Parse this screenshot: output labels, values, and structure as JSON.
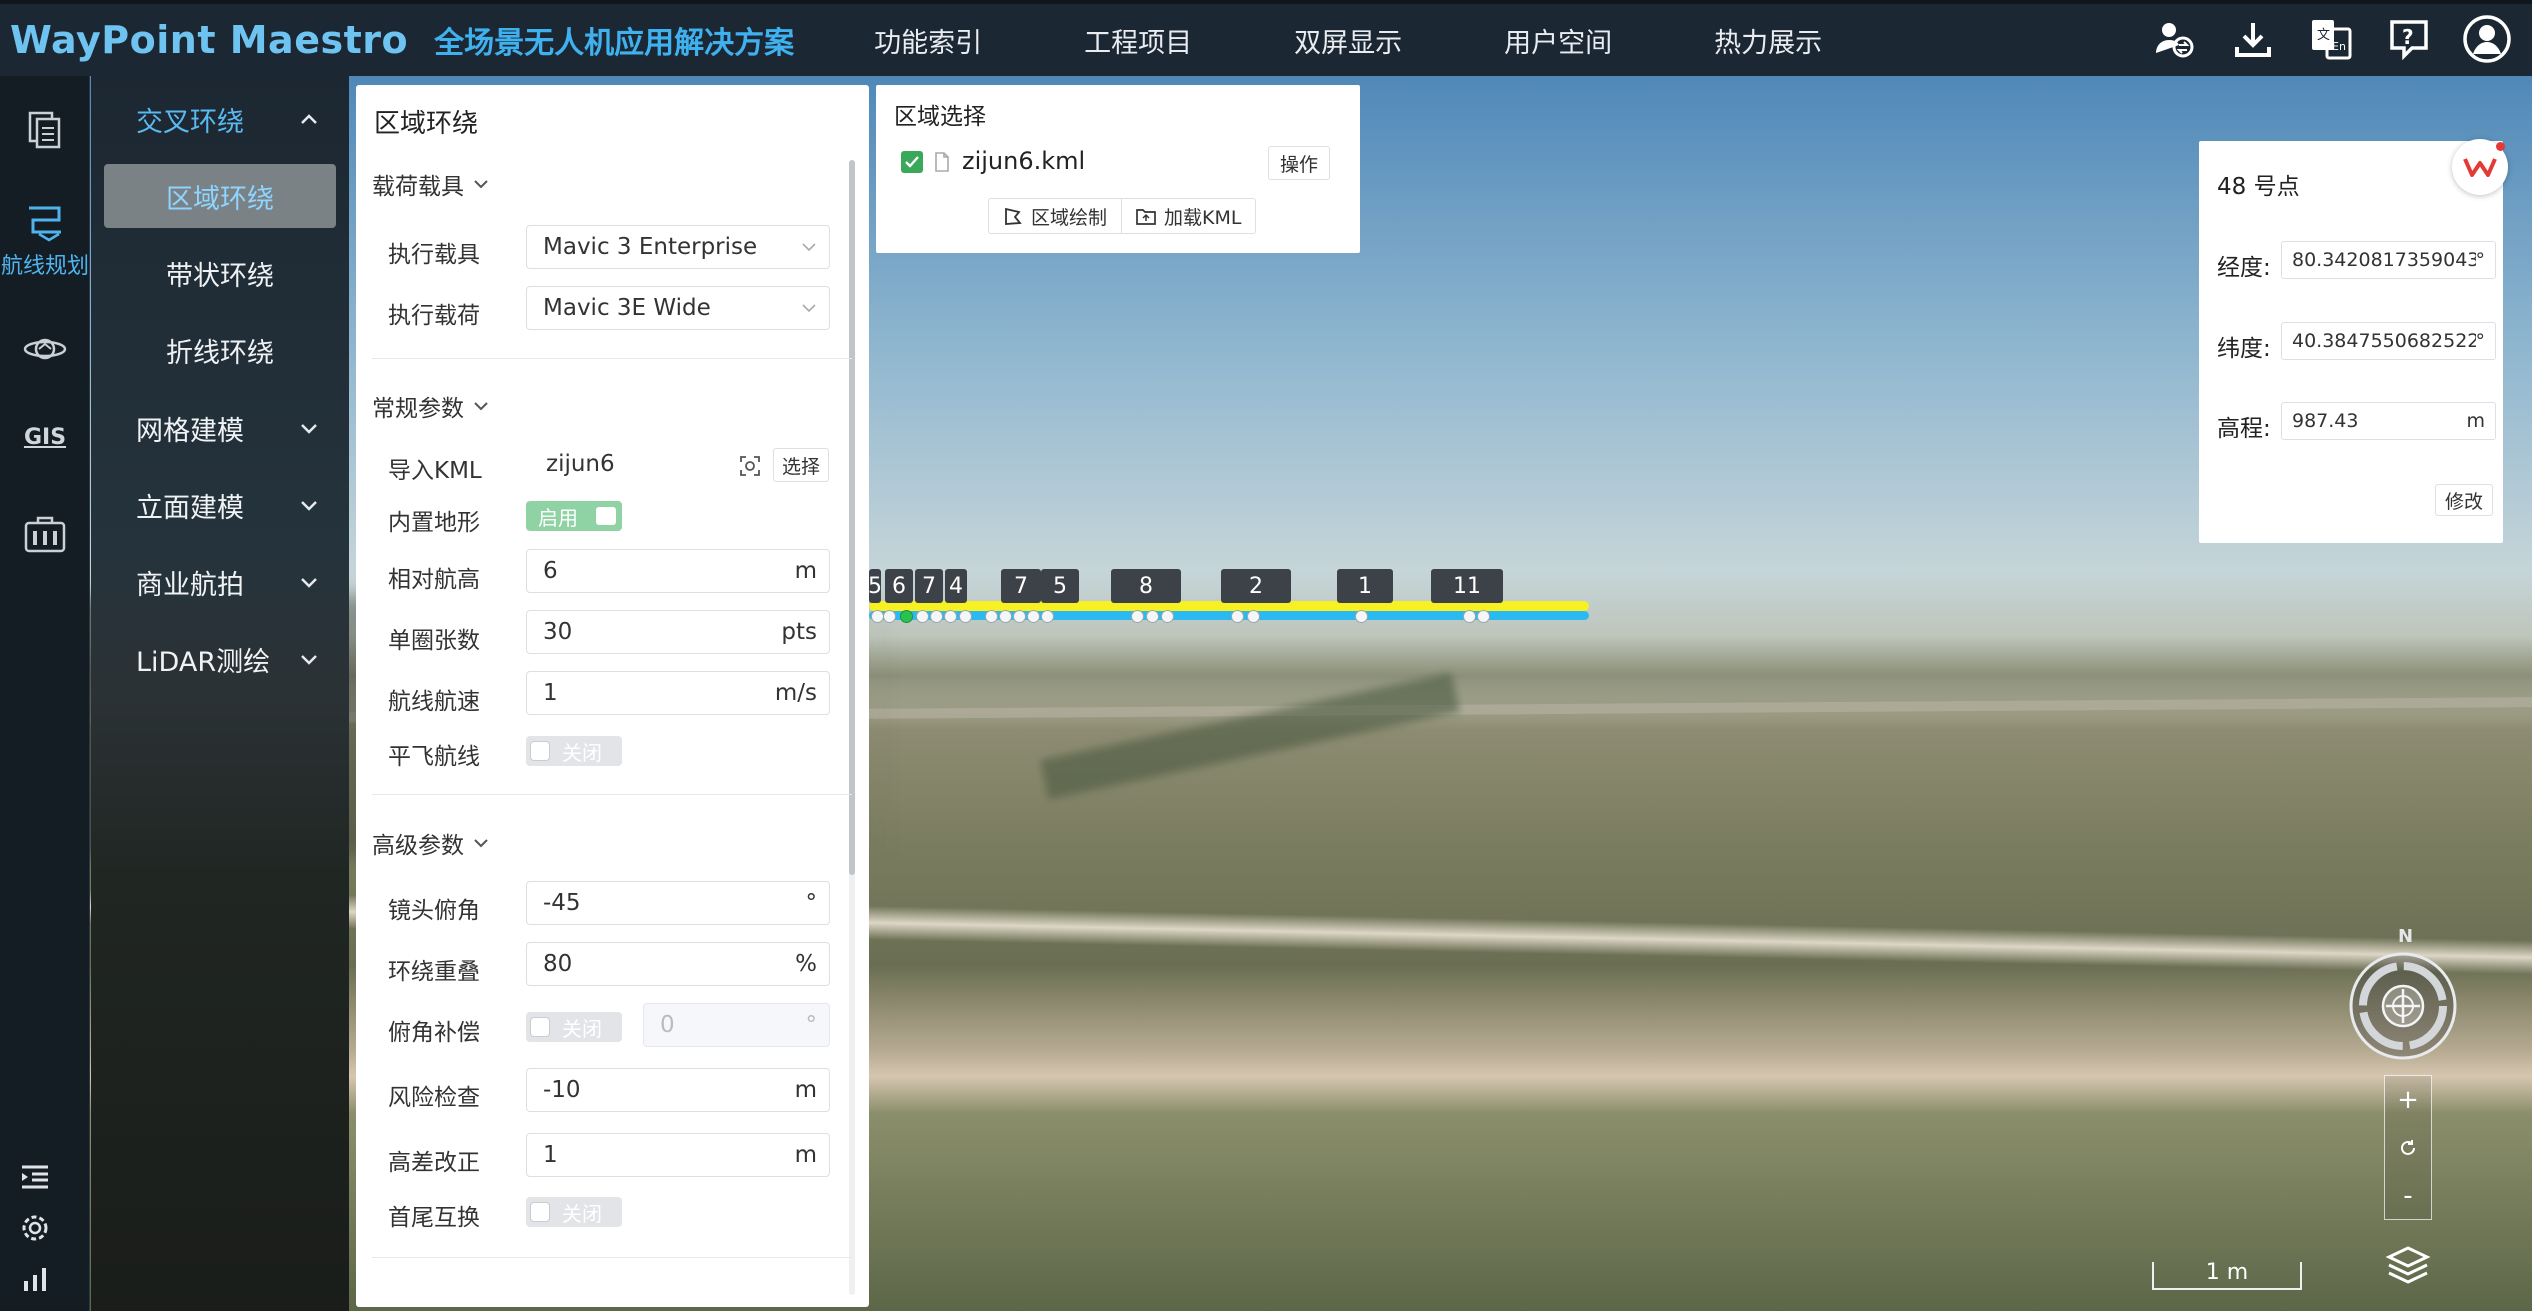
{
  "header": {
    "brand": "WayPoint Maestro",
    "slogan": "全场景无人机应用解决方案",
    "nav": [
      "功能索引",
      "工程项目",
      "双屏显示",
      "用户空间",
      "热力展示"
    ],
    "icons": [
      "user-switch-icon",
      "download-icon",
      "translate-icon",
      "help-icon",
      "account-icon"
    ]
  },
  "iconbar": {
    "items": [
      {
        "icon": "documents-icon"
      },
      {
        "icon": "route-planning-icon",
        "label": "航线规划"
      },
      {
        "icon": "drone-orbit-icon"
      },
      {
        "icon": "gis-icon",
        "label": "GIS"
      },
      {
        "icon": "toolbox-icon"
      }
    ],
    "bottom_icons": [
      "collapse-menu-icon",
      "settings-icon",
      "stats-icon"
    ]
  },
  "submenu": {
    "groups": [
      {
        "label": "交叉环绕",
        "expanded": true
      },
      {
        "label": "网格建模"
      },
      {
        "label": "立面建模"
      },
      {
        "label": "商业航拍"
      },
      {
        "label": "LiDAR测绘"
      }
    ],
    "subitems": [
      {
        "label": "区域环绕",
        "selected": true
      },
      {
        "label": "带状环绕"
      },
      {
        "label": "折线环绕"
      }
    ]
  },
  "panel": {
    "title": "区域环绕",
    "sections": {
      "payload": "载荷载具",
      "general": "常规参数",
      "advanced": "高级参数"
    },
    "fields": {
      "vehicle": {
        "label": "执行载具",
        "value": "Mavic 3 Enterprise"
      },
      "payload": {
        "label": "执行载荷",
        "value": "Mavic 3E Wide"
      },
      "kml": {
        "label": "导入KML",
        "value": "zijun6",
        "button": "选择"
      },
      "terrain": {
        "label": "内置地形",
        "state": "启用"
      },
      "altitude": {
        "label": "相对航高",
        "value": "6",
        "unit": "m"
      },
      "shots": {
        "label": "单圈张数",
        "value": "30",
        "unit": "pts"
      },
      "speed": {
        "label": "航线航速",
        "value": "1",
        "unit": "m/s"
      },
      "level_flight": {
        "label": "平飞航线",
        "state": "关闭"
      },
      "pitch": {
        "label": "镜头俯角",
        "value": "-45",
        "unit": "°"
      },
      "overlap": {
        "label": "环绕重叠",
        "value": "80",
        "unit": "%"
      },
      "pitch_comp": {
        "label": "俯角补偿",
        "state": "关闭",
        "value": "0",
        "unit": "°"
      },
      "risk": {
        "label": "风险检查",
        "value": "-10",
        "unit": "m"
      },
      "height_fix": {
        "label": "高差改正",
        "value": "1",
        "unit": "m"
      },
      "swap": {
        "label": "首尾互换",
        "state": "关闭"
      }
    }
  },
  "region": {
    "title": "区域选择",
    "file": "zijun6.kml",
    "checked": true,
    "op_button": "操作",
    "draw_button": "区域绘制",
    "load_button": "加载KML"
  },
  "waypoint": {
    "title": "48 号点",
    "lon_label": "经度:",
    "lon_value": "80.3420817359043",
    "lon_unit": "°",
    "lat_label": "纬度:",
    "lat_value": "40.3847550682522",
    "lat_unit": "°",
    "alt_label": "高程:",
    "alt_value": "987.43",
    "alt_unit": "m",
    "edit_button": "修改"
  },
  "map": {
    "waypoint_tags": [
      "5",
      "6",
      "7",
      "4",
      "7",
      "5",
      "8",
      "2",
      "1",
      "11"
    ],
    "compass_north": "N",
    "zoom_in": "+",
    "zoom_out": "-",
    "scale": "1 m",
    "colors": {
      "path_top": "#f7f124",
      "path_bottom": "#2bb9f1",
      "accent": "#3fb1ef"
    }
  }
}
